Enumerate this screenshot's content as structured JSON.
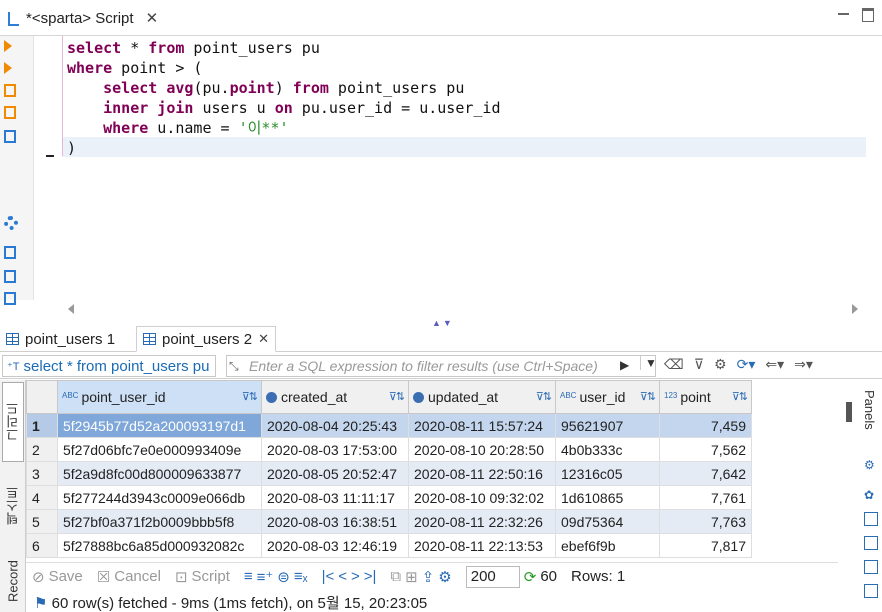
{
  "editor_tab": {
    "title": "*<sparta> Script"
  },
  "sql_lines": [
    {
      "tokens": [
        {
          "t": "select",
          "c": "kw"
        },
        {
          "t": " * ",
          "c": ""
        },
        {
          "t": "from",
          "c": "kw"
        },
        {
          "t": " point_users pu",
          "c": ""
        }
      ]
    },
    {
      "tokens": [
        {
          "t": "where",
          "c": "kw"
        },
        {
          "t": " point > (",
          "c": ""
        }
      ]
    },
    {
      "tokens": [
        {
          "t": "    ",
          "c": ""
        },
        {
          "t": "select",
          "c": "kw"
        },
        {
          "t": " ",
          "c": ""
        },
        {
          "t": "avg",
          "c": "kw"
        },
        {
          "t": "(pu.",
          "c": ""
        },
        {
          "t": "point",
          "c": "kw"
        },
        {
          "t": ") ",
          "c": ""
        },
        {
          "t": "from",
          "c": "kw"
        },
        {
          "t": " point_users pu",
          "c": ""
        }
      ]
    },
    {
      "tokens": [
        {
          "t": "    ",
          "c": ""
        },
        {
          "t": "inner join",
          "c": "kw"
        },
        {
          "t": " users u ",
          "c": ""
        },
        {
          "t": "on",
          "c": "kw"
        },
        {
          "t": " pu.user_id = u.user_id",
          "c": ""
        }
      ]
    },
    {
      "tokens": [
        {
          "t": "    ",
          "c": ""
        },
        {
          "t": "where",
          "c": "kw"
        },
        {
          "t": " u.name = ",
          "c": ""
        },
        {
          "t": "'이**'",
          "c": "str"
        }
      ]
    },
    {
      "tokens": [
        {
          "t": ")",
          "c": ""
        }
      ]
    }
  ],
  "result_tabs": [
    {
      "label": "point_users 1"
    },
    {
      "label": "point_users 2",
      "close": "✕"
    }
  ],
  "filter": {
    "query_text": "select * from point_users pu",
    "placeholder": "Enter a SQL expression to filter results (use Ctrl+Space)"
  },
  "vertical_tabs": {
    "grid": "그리드",
    "text": "텍스트",
    "record": "Record"
  },
  "panels_label": "Panels",
  "columns": [
    {
      "name": "point_user_id",
      "type_icon": "ABC"
    },
    {
      "name": "created_at",
      "type_icon": "clock"
    },
    {
      "name": "updated_at",
      "type_icon": "clock"
    },
    {
      "name": "user_id",
      "type_icon": "ABC"
    },
    {
      "name": "point",
      "type_icon": "123"
    }
  ],
  "rows": [
    [
      "1",
      "5f2945b77d52a200093197d1",
      "2020-08-04 20:25:43",
      "2020-08-11 15:57:24",
      "95621907",
      "7,459"
    ],
    [
      "2",
      "5f27d06bfc7e0e000993409e",
      "2020-08-03 17:53:00",
      "2020-08-10 20:28:50",
      "4b0b333c",
      "7,562"
    ],
    [
      "3",
      "5f2a9d8fc00d800009633877",
      "2020-08-05 20:52:47",
      "2020-08-11 22:50:16",
      "12316c05",
      "7,642"
    ],
    [
      "4",
      "5f277244d3943c0009e066db",
      "2020-08-03 11:11:17",
      "2020-08-10 09:32:02",
      "1d610865",
      "7,761"
    ],
    [
      "5",
      "5f27bf0a371f2b0009bbb5f8",
      "2020-08-03 16:38:51",
      "2020-08-11 22:32:26",
      "09d75364",
      "7,763"
    ],
    [
      "6",
      "5f27888bc6a85d000932082c",
      "2020-08-03 12:46:19",
      "2020-08-11 22:13:53",
      "ebef6f9b",
      "7,817"
    ]
  ],
  "bottom_toolbar": {
    "save": "Save",
    "cancel": "Cancel",
    "script": "Script",
    "fetch_size": "200",
    "refresh_count": "60",
    "rows_label": "Rows: 1"
  },
  "status_text": "60 row(s) fetched - 9ms (1ms fetch), on 5월 15, 20:23:05",
  "colors": {
    "keyword": "#7f0055",
    "string": "#2a8f2a",
    "selection": "#c3d6ee",
    "accent": "#2a6bb5"
  }
}
